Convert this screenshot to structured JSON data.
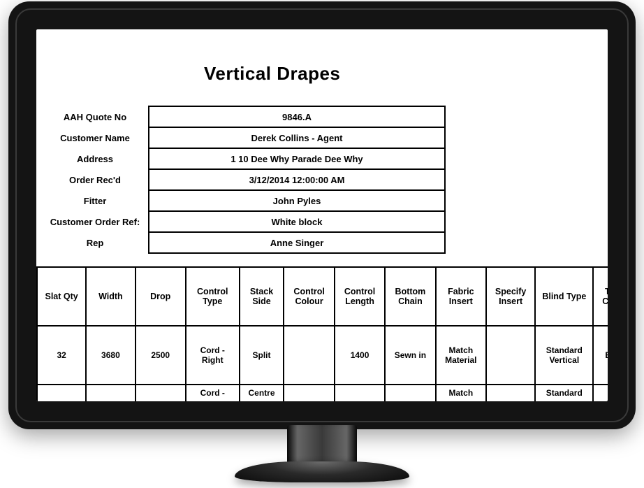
{
  "document": {
    "title": "Vertical Drapes",
    "info": {
      "rows": [
        {
          "label": "AAH Quote No",
          "value": "9846.A"
        },
        {
          "label": "Customer Name",
          "value": "Derek Collins - Agent"
        },
        {
          "label": "Address",
          "value": "1 10 Dee Why Parade Dee Why"
        },
        {
          "label": "Order Rec'd",
          "value": "3/12/2014 12:00:00 AM"
        },
        {
          "label": "Fitter",
          "value": "John Pyles"
        },
        {
          "label": "Customer Order Ref:",
          "value": "White block"
        },
        {
          "label": "Rep",
          "value": "Anne Singer"
        }
      ]
    },
    "grid": {
      "headers": [
        "Slat Qty",
        "Width",
        "Drop",
        "Control Type",
        "Stack Side",
        "Control Colour",
        "Control Length",
        "Bottom Chain",
        "Fabric Insert",
        "Specify Insert",
        "Blind Type",
        "Track Colour",
        ""
      ],
      "rows": [
        {
          "slat_qty": "32",
          "width": "3680",
          "drop": "2500",
          "control_type": "Cord - Right",
          "stack_side": "Split",
          "control_colour": "",
          "control_length": "1400",
          "bottom_chain": "Sewn in",
          "fabric_insert": "Match Material",
          "specify_insert": "",
          "blind_type": "Standard Vertical",
          "track_colour": "Black",
          "extra": ""
        },
        {
          "slat_qty": "",
          "width": "",
          "drop": "",
          "control_type": "Cord -",
          "stack_side": "Centre",
          "control_colour": "",
          "control_length": "",
          "bottom_chain": "",
          "fabric_insert": "Match",
          "specify_insert": "",
          "blind_type": "Standard",
          "track_colour": "",
          "extra": ""
        }
      ]
    }
  }
}
